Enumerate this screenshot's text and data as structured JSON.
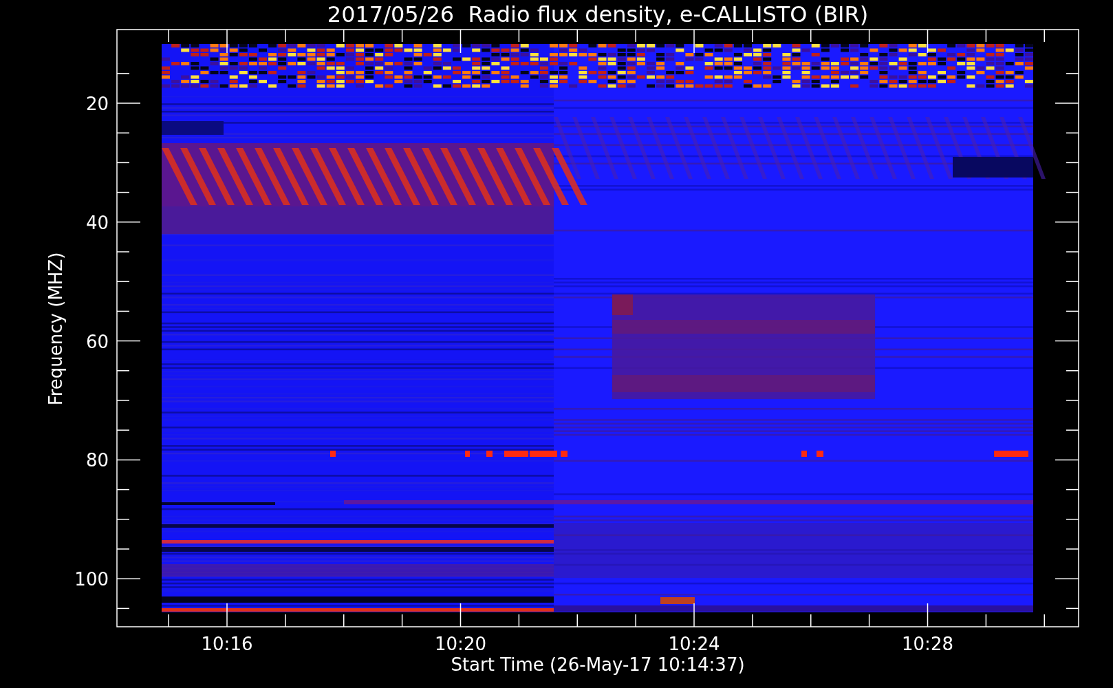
{
  "title": "2017/05/26  Radio flux density, e-CALLISTO (BIR)",
  "ylabel": "Frequency (MHZ)",
  "xlabel": "Start Time (26-May-17 10:14:37)",
  "yticks": [
    "20",
    "40",
    "60",
    "80",
    "100"
  ],
  "xticks": [
    "10:16",
    "10:20",
    "10:24",
    "10:28"
  ]
}
